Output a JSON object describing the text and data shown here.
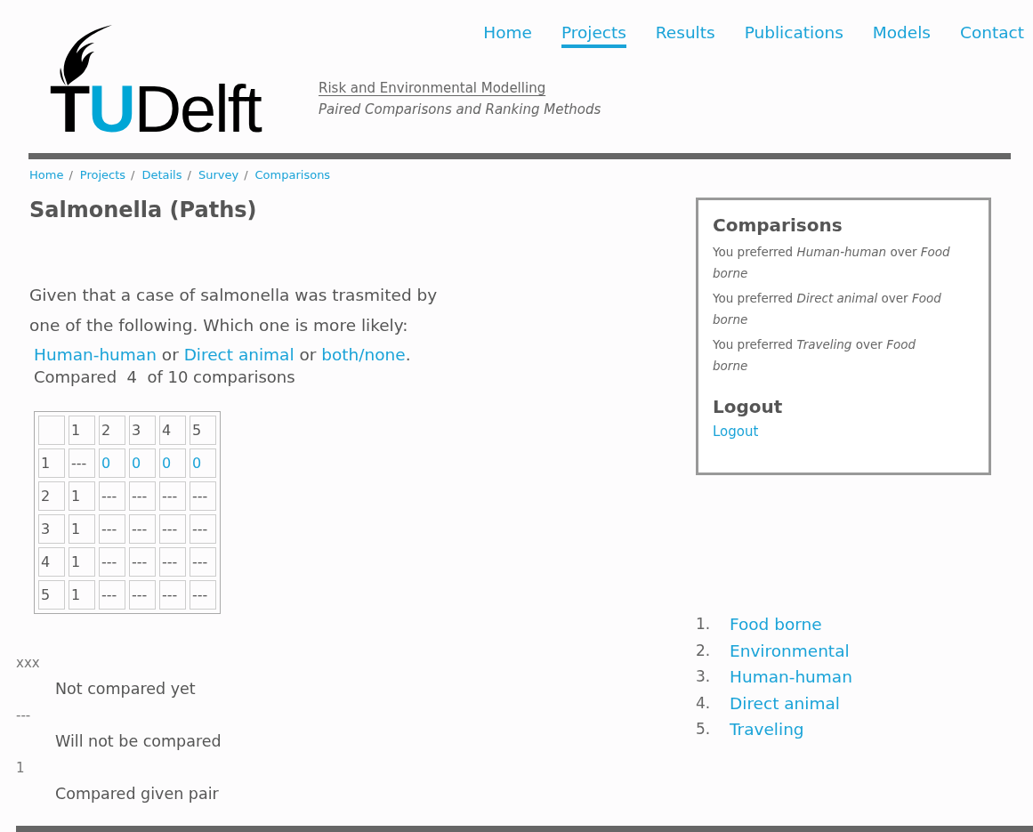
{
  "logo": {
    "parts": [
      {
        "text": "T",
        "color": "#000000"
      },
      {
        "text": "U",
        "color": "#00a6d6"
      },
      {
        "text": "Delft",
        "color": "#000000"
      }
    ]
  },
  "site": {
    "title": "Risk and Environmental Modelling",
    "subtitle": "Paired Comparisons and Ranking Methods"
  },
  "nav": [
    {
      "label": "Home",
      "selected": false
    },
    {
      "label": "Projects",
      "selected": true
    },
    {
      "label": "Results",
      "selected": false
    },
    {
      "label": "Publications",
      "selected": false
    },
    {
      "label": "Models",
      "selected": false
    },
    {
      "label": "Contact",
      "selected": false
    }
  ],
  "breadcrumb": [
    {
      "label": "Home",
      "separator": "/"
    },
    {
      "label": "Projects",
      "separator": "/"
    },
    {
      "label": "Details",
      "separator": "/"
    },
    {
      "label": "Survey",
      "separator": "/"
    },
    {
      "label": "Comparisons"
    }
  ],
  "heading": "Salmonella (Paths)",
  "question": "Given that a case of salmonella was trasmited by one of the following. Which one is more likely:",
  "options": [
    {
      "kind": "link",
      "text": "Human-human"
    },
    {
      "kind": "text",
      "text": " or "
    },
    {
      "kind": "link",
      "text": "Direct animal"
    },
    {
      "kind": "text",
      "text": " or "
    },
    {
      "kind": "link",
      "text": "both/none"
    },
    {
      "kind": "text",
      "text": "."
    }
  ],
  "progress": "Compared  4  of 10 comparisons",
  "matrix": {
    "rows": [
      [
        {
          "kind": "blank"
        },
        {
          "kind": "text",
          "text": "1"
        },
        {
          "kind": "text",
          "text": "2"
        },
        {
          "kind": "text",
          "text": "3"
        },
        {
          "kind": "text",
          "text": "4"
        },
        {
          "kind": "text",
          "text": "5"
        }
      ],
      [
        {
          "kind": "text",
          "text": "1"
        },
        {
          "kind": "text",
          "text": "---"
        },
        {
          "kind": "link",
          "text": "0"
        },
        {
          "kind": "link",
          "text": "0"
        },
        {
          "kind": "link",
          "text": "0"
        },
        {
          "kind": "link",
          "text": "0"
        }
      ],
      [
        {
          "kind": "text",
          "text": "2"
        },
        {
          "kind": "text",
          "text": "1"
        },
        {
          "kind": "text",
          "text": "---"
        },
        {
          "kind": "text",
          "text": "---"
        },
        {
          "kind": "text",
          "text": "---"
        },
        {
          "kind": "text",
          "text": "---"
        }
      ],
      [
        {
          "kind": "text",
          "text": "3"
        },
        {
          "kind": "text",
          "text": "1"
        },
        {
          "kind": "text",
          "text": "---"
        },
        {
          "kind": "text",
          "text": "---"
        },
        {
          "kind": "text",
          "text": "---"
        },
        {
          "kind": "text",
          "text": "---"
        }
      ],
      [
        {
          "kind": "text",
          "text": "4"
        },
        {
          "kind": "text",
          "text": "1"
        },
        {
          "kind": "text",
          "text": "---"
        },
        {
          "kind": "text",
          "text": "---"
        },
        {
          "kind": "text",
          "text": "---"
        },
        {
          "kind": "text",
          "text": "---"
        }
      ],
      [
        {
          "kind": "text",
          "text": "5"
        },
        {
          "kind": "text",
          "text": "1"
        },
        {
          "kind": "text",
          "text": "---"
        },
        {
          "kind": "text",
          "text": "---"
        },
        {
          "kind": "text",
          "text": "---"
        },
        {
          "kind": "text",
          "text": "---"
        }
      ]
    ]
  },
  "legend": [
    {
      "term": "xxx",
      "description": "Not compared yet"
    },
    {
      "term": "---",
      "description": "Will not be compared"
    },
    {
      "term": "1",
      "description": "Compared given pair"
    }
  ],
  "sidebar": {
    "title": "Comparisons",
    "preferences": [
      "You preferred *Human-human* over *Food borne*",
      "You preferred *Direct animal* over *Food borne*",
      "You preferred *Traveling* over *Food borne*"
    ],
    "logout_title": "Logout",
    "logout_link": "Logout"
  },
  "ranking": [
    {
      "number": "1.",
      "label": "Food borne"
    },
    {
      "number": "2.",
      "label": "Environmental"
    },
    {
      "number": "3.",
      "label": "Human-human"
    },
    {
      "number": "4.",
      "label": "Direct animal"
    },
    {
      "number": "5.",
      "label": "Traveling"
    }
  ]
}
